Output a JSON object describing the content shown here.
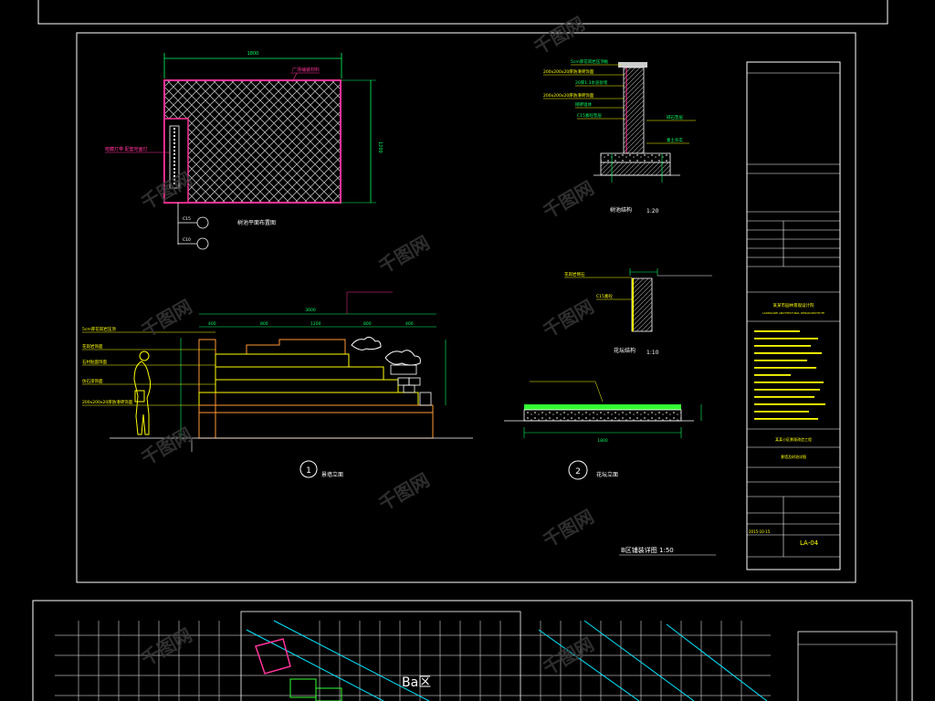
{
  "drawing": {
    "plan_label": "树池平面布置图",
    "plan_dim_top": "1800",
    "plan_dim_side": "1200",
    "plan_note": "广场铺装材料",
    "plan_side_note": "暗藏灯带 配套地面灯",
    "plan_callout_1": "C15",
    "plan_callout_2": "C10",
    "section_title": "树池结构",
    "section_scale": "1:20",
    "section_notes": [
      "5cm厚花岗岩压顶板",
      "200x200x20厚防滑砖饰面",
      "200x200x20厚防滑砖饰面",
      "20厚1:3水泥砂浆",
      "砌砖墙体",
      "C15素砼垫层",
      "碎石垫层",
      "素土夯实"
    ],
    "curb_title": "花坛结构",
    "curb_scale": "1:10",
    "curb_note_1": "花岗岩侧石",
    "curb_note_2": "C15素砼",
    "elevation_title": "景墙立面",
    "elevation_number": "1",
    "elevation_dims": [
      "400",
      "800",
      "1200",
      "800",
      "400"
    ],
    "elevation_total": "3600",
    "elevation_notes": [
      "5cm厚花岗岩压顶",
      "花岗岩饰面",
      "石材贴面饰面",
      "仿石漆饰面",
      "200x200x20厚防滑砖饰面"
    ],
    "planter_title": "花坛立面",
    "planter_number": "2",
    "planter_dim": "1800",
    "sheet_label": "B区铺装详图  1:50"
  },
  "title_block": {
    "company": "某某市园林景观设计院",
    "company_en": "LANDSCAPE ARCHITECTURAL DESIGN INSTITUTE",
    "project": "某某小区景观改造工程",
    "drawing_name": "景墙及树池详图",
    "date": "2015-10-15",
    "drawing_no": "LA-04"
  },
  "lower_sheet": {
    "zone_label": "Ba区"
  },
  "watermark": "千图网",
  "colors": {
    "bg": "#000000",
    "frame": "#ffffff",
    "magenta": "#ff3399",
    "yellow": "#ffff00",
    "green": "#33ff33",
    "cyan": "#00e5ff",
    "orange": "#ff9933"
  }
}
